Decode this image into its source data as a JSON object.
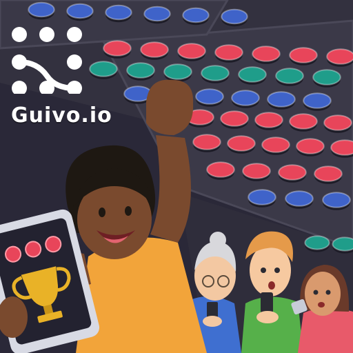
{
  "brand": {
    "name": "Guivo.io",
    "logo_icon": "dot-grid-logo-icon"
  },
  "scene": {
    "board": "colored-chip-board",
    "phone_icon": "trophy-icon",
    "phone_indicators": 3
  },
  "colors": {
    "background": "#2a2838",
    "board": "#3b3948",
    "chip_red": "#e8455a",
    "chip_blue": "#3f63c9",
    "chip_teal": "#1f9d8a",
    "chip_green": "#8fb84a",
    "chip_purple": "#7a4aa8",
    "shirt": "#f2a43a",
    "trophy": "#e9b227"
  }
}
